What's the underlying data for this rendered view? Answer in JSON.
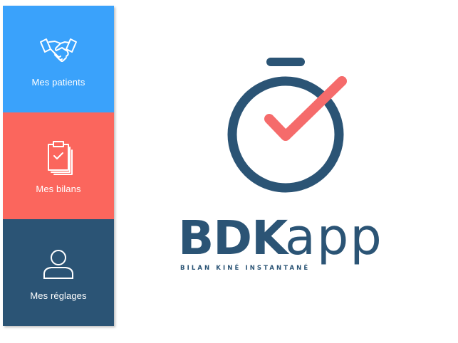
{
  "sidebar": {
    "items": [
      {
        "label": "Mes patients",
        "icon": "handshake-icon",
        "color": "#3aa2fb"
      },
      {
        "label": "Mes bilans",
        "icon": "clipboard-check-icon",
        "color": "#fb665d"
      },
      {
        "label": "Mes réglages",
        "icon": "user-icon",
        "color": "#2b5475"
      }
    ]
  },
  "logo": {
    "brand_main": "BDK",
    "brand_sub": "app",
    "tagline": "BILAN KINÉ INSTANTANÉ",
    "primary_color": "#2b5475",
    "accent_color": "#f56b6b"
  }
}
